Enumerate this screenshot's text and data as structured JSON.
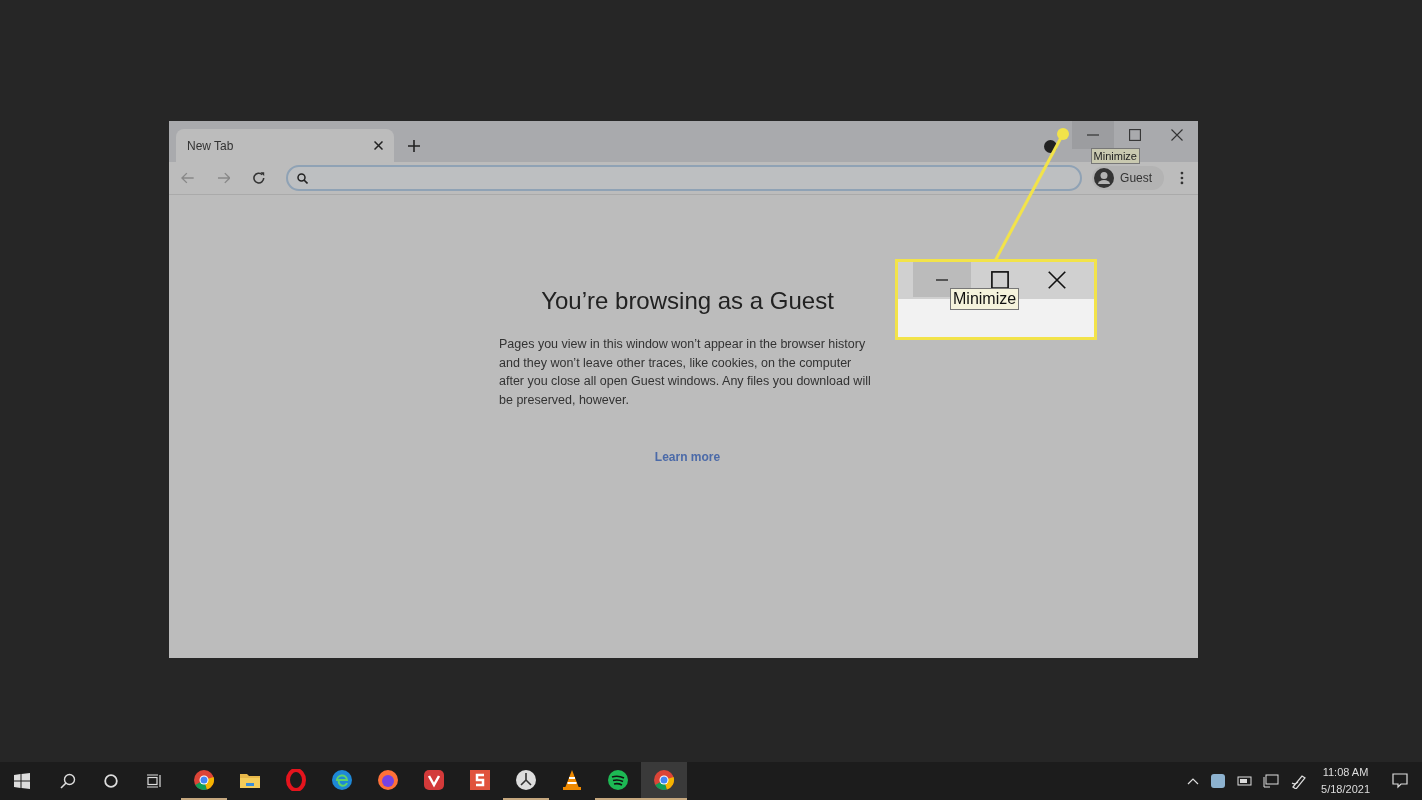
{
  "browser": {
    "tabs": [
      {
        "label": "New Tab",
        "selected": true
      }
    ],
    "window_buttons": [
      {
        "kind": "minimize",
        "hovered": true
      },
      {
        "kind": "maximize",
        "hovered": false
      },
      {
        "kind": "close",
        "hovered": false
      }
    ],
    "tooltip": "Minimize",
    "profile": "Guest"
  },
  "page": {
    "heading": "You’re browsing as a Guest",
    "body": "Pages you view in this window won’t appear in the browser history and they won’t leave other traces, like cookies, on the computer after you close all open Guest windows. Any files you download will be preserved, however.",
    "link": "Learn more"
  },
  "callout": {
    "window_buttons": [
      {
        "kind": "minimize",
        "hovered": true
      },
      {
        "kind": "maximize",
        "hovered": false
      },
      {
        "kind": "close",
        "hovered": false
      }
    ],
    "tooltip": "Minimize"
  },
  "taskbar": {
    "apps": [
      {
        "kind": "chrome",
        "running": true,
        "selected": false
      },
      {
        "kind": "folder",
        "running": false,
        "selected": false
      },
      {
        "kind": "opera",
        "running": false,
        "selected": false
      },
      {
        "kind": "edge",
        "running": false,
        "selected": false
      },
      {
        "kind": "firefox",
        "running": false,
        "selected": false
      },
      {
        "kind": "vivaldi",
        "running": false,
        "selected": false
      },
      {
        "kind": "letter",
        "running": false,
        "selected": false
      },
      {
        "kind": "clock",
        "running": true,
        "selected": false
      },
      {
        "kind": "cone",
        "running": false,
        "selected": false
      },
      {
        "kind": "spotify",
        "running": true,
        "selected": false
      },
      {
        "kind": "chrome",
        "running": true,
        "selected": true
      }
    ],
    "time": "11:08 AM",
    "date": "5/18/2021"
  }
}
